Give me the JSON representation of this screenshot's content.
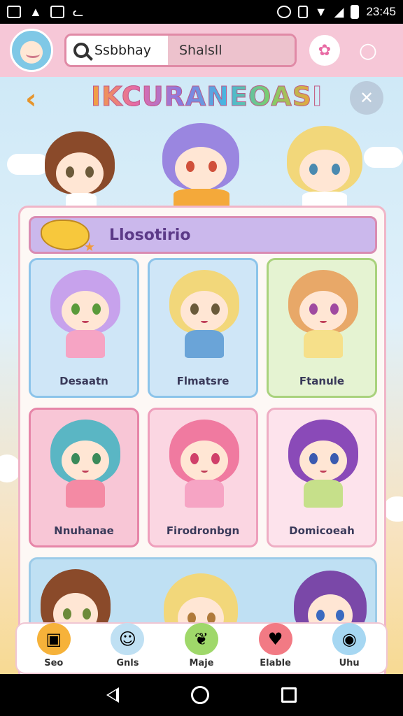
{
  "status_bar": {
    "time": "23:45",
    "left_icons": [
      "image-icon",
      "notification-icon",
      "photo-icon",
      "cat-icon"
    ],
    "right_icons": [
      "alarm-icon",
      "vibrate-icon",
      "wifi-icon",
      "signal-icon",
      "battery-icon"
    ]
  },
  "header": {
    "search_text": "Ssbbhay",
    "search_tab": "Shalsll"
  },
  "page": {
    "title": "IKCURANEOASI"
  },
  "section": {
    "title": "Llosotirio"
  },
  "cards": [
    {
      "label": "Desaatn",
      "bg": "#cfe6f7",
      "border": "#8cc4ea"
    },
    {
      "label": "Flmatsre",
      "bg": "#cfe6f7",
      "border": "#8cc4ea"
    },
    {
      "label": "Ftanule",
      "bg": "#e5f3d2",
      "border": "#a9d27d"
    },
    {
      "label": "Nnuhanae",
      "bg": "#f8c6d6",
      "border": "#e685a8"
    },
    {
      "label": "Firodronbgn",
      "bg": "#fbd6e2",
      "border": "#ee9fbc"
    },
    {
      "label": "Domicoeah",
      "bg": "#fde3ec",
      "border": "#eeaec4"
    }
  ],
  "bottom_nav": [
    {
      "label": "Seo",
      "icon": "shopping-bag-icon",
      "color": "#f6b23a"
    },
    {
      "label": "Gnls",
      "icon": "character-icon",
      "color": "#bfe0f3"
    },
    {
      "label": "Maje",
      "icon": "leaf-icon",
      "color": "#9fd86a"
    },
    {
      "label": "Elable",
      "icon": "heart-icon",
      "color": "#f27a84"
    },
    {
      "label": "Uhu",
      "icon": "drink-icon",
      "color": "#a6d7f2"
    }
  ],
  "colors": {
    "accent_pink": "#f6c7d7",
    "accent_purple": "#cbb8ec",
    "back_orange": "#e6952c"
  }
}
